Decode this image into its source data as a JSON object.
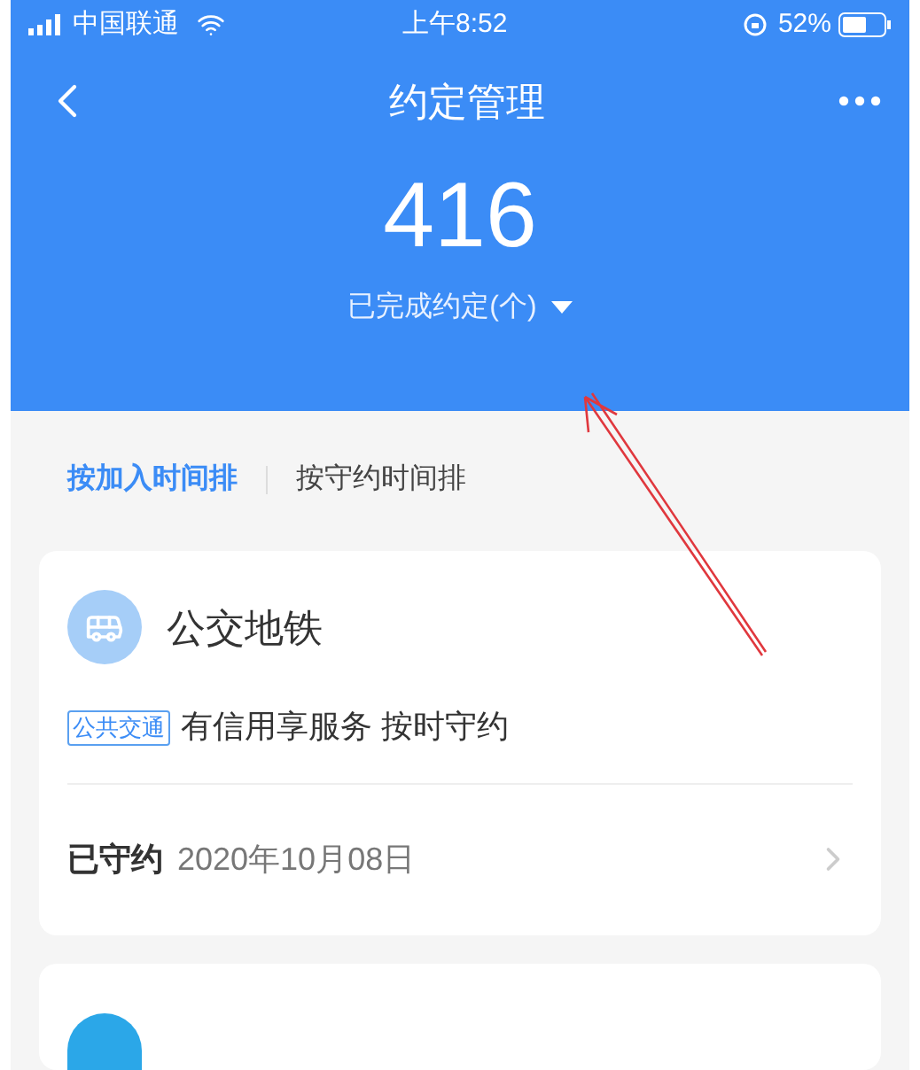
{
  "status_bar": {
    "carrier": "中国联通",
    "time": "上午8:52",
    "battery": "52%"
  },
  "nav": {
    "title": "约定管理"
  },
  "summary": {
    "count": "416",
    "label": "已完成约定(个)"
  },
  "sort_tabs": [
    {
      "label": "按加入时间排",
      "selected": true
    },
    {
      "label": "按守约时间排",
      "selected": false
    }
  ],
  "cards": [
    {
      "title": "公交地铁",
      "tag": "公共交通",
      "description": "有信用享服务 按时守约",
      "status": "已守约",
      "date": "2020年10月08日"
    }
  ]
}
